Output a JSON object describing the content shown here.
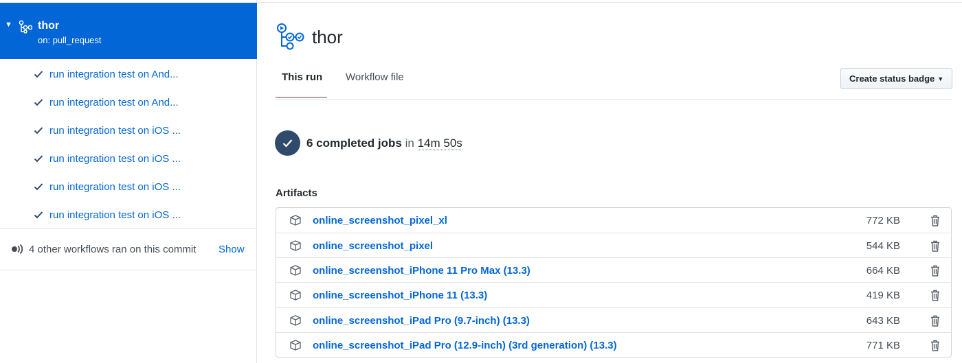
{
  "sidebar": {
    "workflow": {
      "name": "thor",
      "trigger": "on: pull_request"
    },
    "jobs": [
      {
        "label": "run integration test on And...",
        "status": "success"
      },
      {
        "label": "run integration test on And...",
        "status": "success"
      },
      {
        "label": "run integration test on iOS ...",
        "status": "success"
      },
      {
        "label": "run integration test on iOS ...",
        "status": "success"
      },
      {
        "label": "run integration test on iOS ...",
        "status": "success"
      },
      {
        "label": "run integration test on iOS ...",
        "status": "success"
      }
    ],
    "other_workflows": {
      "text": "4 other workflows ran on this commit",
      "show_label": "Show"
    }
  },
  "main": {
    "title": "thor",
    "tabs": [
      {
        "label": "This run",
        "active": true
      },
      {
        "label": "Workflow file",
        "active": false
      }
    ],
    "status_badge_button": "Create status badge",
    "summary": {
      "jobs_text": "6 completed jobs",
      "in_text": "in",
      "duration": "14m 50s"
    },
    "artifacts_heading": "Artifacts",
    "artifacts": [
      {
        "name": "online_screenshot_pixel_xl",
        "size": "772 KB"
      },
      {
        "name": "online_screenshot_pixel",
        "size": "544 KB"
      },
      {
        "name": "online_screenshot_iPhone 11 Pro Max (13.3)",
        "size": "664 KB"
      },
      {
        "name": "online_screenshot_iPhone 11 (13.3)",
        "size": "419 KB"
      },
      {
        "name": "online_screenshot_iPad Pro (9.7-inch) (13.3)",
        "size": "643 KB"
      },
      {
        "name": "online_screenshot_iPad Pro (12.9-inch) (3rd generation) (13.3)",
        "size": "771 KB"
      }
    ]
  },
  "colors": {
    "link": "#0366d6",
    "selected_bg": "#0366d6",
    "status_circle": "#2f4a6b"
  },
  "icons": {
    "workflow": "workflow-icon",
    "check": "check-icon",
    "other_workflows": "broadcast-icon",
    "artifact": "package-icon",
    "delete": "trash-icon"
  }
}
